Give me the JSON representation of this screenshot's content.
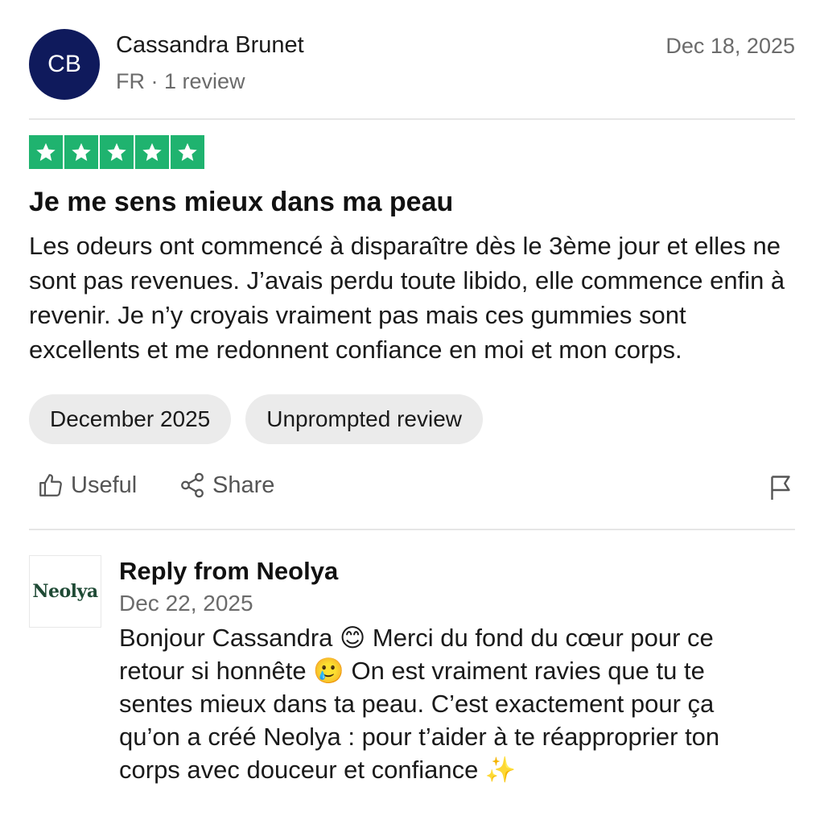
{
  "reviewer": {
    "initials": "CB",
    "name": "Cassandra Brunet",
    "meta": "FR · 1 review",
    "date": "Dec 18, 2025"
  },
  "rating": {
    "stars": 5,
    "color": "#1fb36f"
  },
  "review": {
    "title": "Je me sens mieux dans ma peau",
    "body": "Les odeurs ont commencé à disparaître dès le 3ème jour et elles ne sont pas revenues. J’avais perdu toute libido, elle commence enfin à revenir. Je n’y croyais vraiment pas mais ces gummies sont excellents et me redonnent confiance en moi et mon corps."
  },
  "chips": [
    {
      "label": "December 2025"
    },
    {
      "label": "Unprompted review"
    }
  ],
  "actions": {
    "useful_label": "Useful",
    "share_label": "Share",
    "useful_icon": "thumbs-up-icon",
    "share_icon": "share-icon",
    "flag_icon": "flag-icon"
  },
  "reply": {
    "logo_text": "Neolya",
    "title": "Reply from Neolya",
    "date": "Dec 22, 2025",
    "body": "Bonjour Cassandra 😊 Merci du fond du cœur pour ce retour si honnête 🥲 On est vraiment ravies que tu te sentes mieux dans ta peau. C’est exactement pour ça qu’on a créé Neolya : pour t’aider à te réapproprier ton corps avec douceur et confiance ✨"
  },
  "colors": {
    "avatar_bg": "#0f1a5c",
    "brand_green": "#1f4a35"
  }
}
